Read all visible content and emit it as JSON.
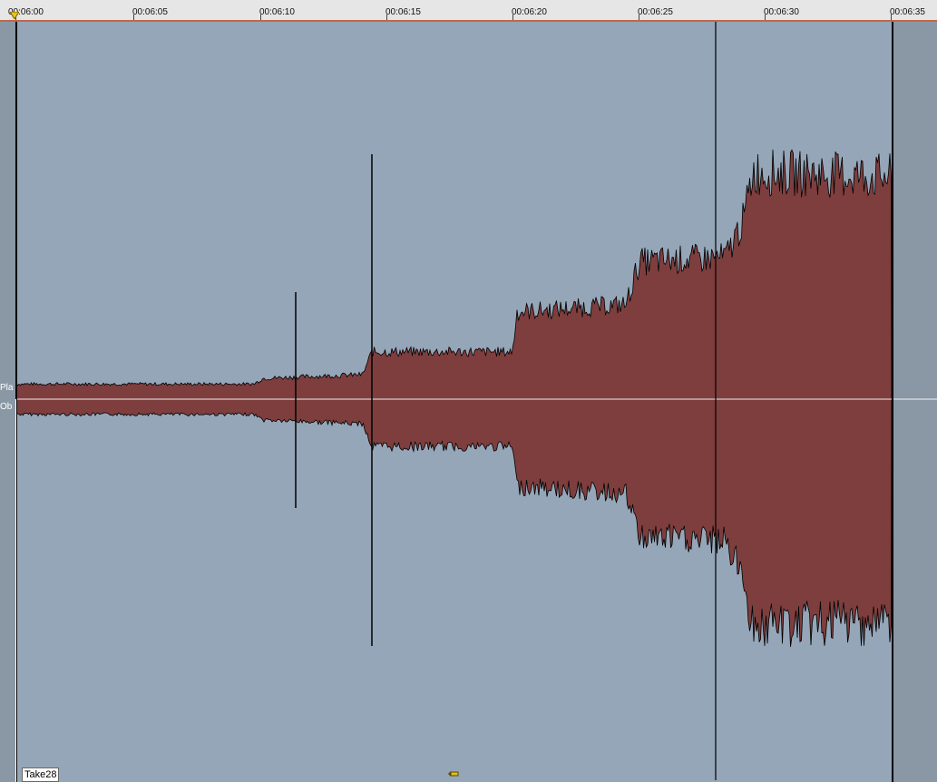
{
  "ruler": {
    "ticks": [
      "00:06:00",
      "00:06:05",
      "00:06:10",
      "00:06:15",
      "00:06:20",
      "00:06:25",
      "00:06:30",
      "00:06:35"
    ]
  },
  "lanes": {
    "upper_label": "Pla",
    "lower_label": "Ob"
  },
  "clip": {
    "name": "Take28"
  },
  "colors": {
    "track_background": "#95a6b8",
    "waveform_fill": "#7e3e3e",
    "waveform_outline": "#000000",
    "ruler_background": "#e6e6e6",
    "center_line": "#ffffff"
  }
}
